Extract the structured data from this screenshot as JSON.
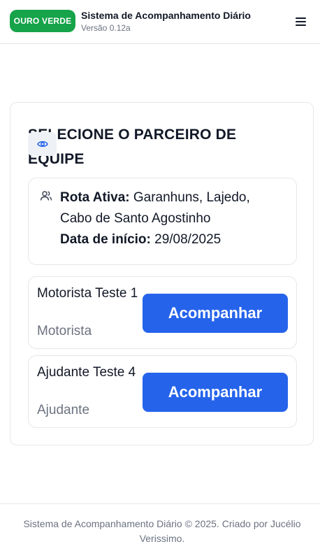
{
  "header": {
    "brand_badge": "OURO VERDE",
    "title": "Sistema de Acompanhamento Diário",
    "version": "Versão 0.12a",
    "menu_icon": "menu-icon"
  },
  "main": {
    "title": "SELECIONE O PARCEIRO DE EQUIPE",
    "view_icon": "eye-icon",
    "route": {
      "icon": "users-icon",
      "active_label": "Rota Ativa:",
      "active_value": "Garanhuns, Lajedo, Cabo de Santo Agostinho",
      "start_label": "Data de início:",
      "start_value": "29/08/2025"
    },
    "partners": [
      {
        "name": "Motorista Teste 1",
        "role": "Motorista",
        "button_label": "Acompanhar"
      },
      {
        "name": "Ajudante Teste 4",
        "role": "Ajudante",
        "button_label": "Acompanhar"
      }
    ]
  },
  "footer": {
    "text": "Sistema de Acompanhamento Diário © 2025. Criado por Jucélio Verissimo."
  },
  "colors": {
    "brand_green": "#16a34a",
    "primary_blue": "#2563eb",
    "muted_text": "#6b7280",
    "border": "#e5e7eb"
  }
}
